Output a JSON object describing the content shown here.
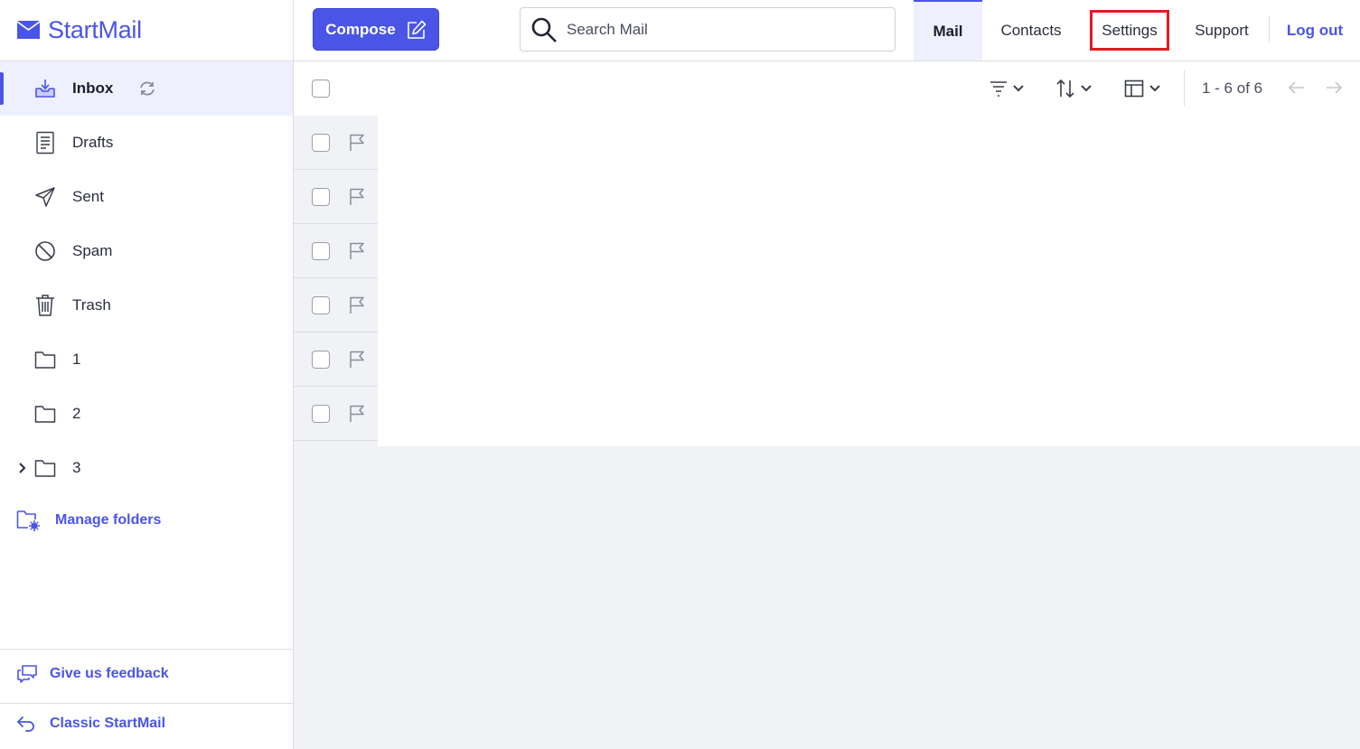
{
  "app": {
    "logo_text": "StartMail"
  },
  "sidebar": {
    "items": [
      {
        "label": "Inbox",
        "icon": "inbox-icon",
        "active": true
      },
      {
        "label": "Drafts",
        "icon": "drafts-icon"
      },
      {
        "label": "Sent",
        "icon": "sent-icon"
      },
      {
        "label": "Spam",
        "icon": "spam-icon"
      },
      {
        "label": "Trash",
        "icon": "trash-icon"
      },
      {
        "label": "1",
        "icon": "folder-icon"
      },
      {
        "label": "2",
        "icon": "folder-icon"
      },
      {
        "label": "3",
        "icon": "folder-icon",
        "expandable": true
      }
    ],
    "manage_folders": "Manage folders",
    "feedback": "Give us feedback",
    "classic": "Classic StartMail"
  },
  "header": {
    "compose_label": "Compose",
    "search_placeholder": "Search Mail",
    "tabs": [
      {
        "label": "Mail",
        "active": true
      },
      {
        "label": "Contacts"
      },
      {
        "label": "Settings",
        "highlighted": true
      },
      {
        "label": "Support"
      },
      {
        "label": "Log out"
      }
    ]
  },
  "toolbar": {
    "pagination": "1 - 6 of 6",
    "tools": [
      "filter-icon",
      "sort-icon",
      "layout-icon"
    ]
  },
  "messages": {
    "count": 6
  },
  "colors": {
    "accent": "#4a55e8",
    "active_bg": "#eef0fd",
    "highlight_box": "#e11b22",
    "list_bg": "#f1f2f6"
  }
}
